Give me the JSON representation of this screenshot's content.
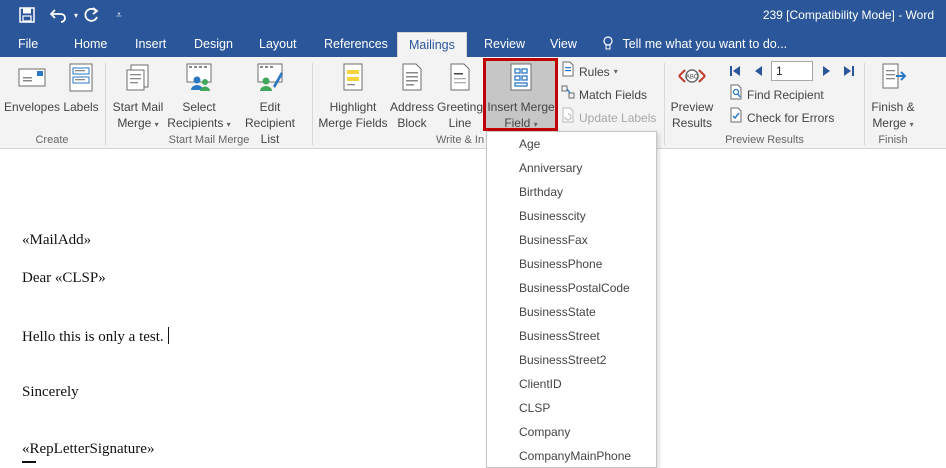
{
  "window": {
    "title": "239 [Compatibility Mode] - Word",
    "qat": {
      "save_icon": "save-icon",
      "undo_icon": "undo-icon",
      "redo_icon": "redo-icon",
      "customize_icon": "customize-qat-icon"
    }
  },
  "tabs": [
    {
      "label": "File"
    },
    {
      "label": "Home"
    },
    {
      "label": "Insert"
    },
    {
      "label": "Design"
    },
    {
      "label": "Layout"
    },
    {
      "label": "References"
    },
    {
      "label": "Mailings"
    },
    {
      "label": "Review"
    },
    {
      "label": "View"
    }
  ],
  "tell_me": "Tell me what you want to do...",
  "ribbon": {
    "create": {
      "label": "Create",
      "envelopes": "Envelopes",
      "labels": "Labels"
    },
    "start_mail_merge": {
      "label": "Start Mail Merge",
      "start_line1": "Start Mail",
      "start_line2": "Merge",
      "select_line1": "Select",
      "select_line2": "Recipients",
      "edit_line1": "Edit",
      "edit_line2": "Recipient List"
    },
    "write_insert": {
      "label": "Write & In",
      "highlight_line1": "Highlight",
      "highlight_line2": "Merge Fields",
      "address_line1": "Address",
      "address_line2": "Block",
      "greeting_line1": "Greeting",
      "greeting_line2": "Line",
      "insert_line1": "Insert Merge",
      "insert_line2": "Field",
      "rules": "Rules",
      "match_fields": "Match Fields",
      "update_labels": "Update Labels"
    },
    "preview_results": {
      "label": "Preview Results",
      "preview_line1": "Preview",
      "preview_line2": "Results",
      "record_number": "1",
      "find_recipient": "Find Recipient",
      "check_errors": "Check for Errors"
    },
    "finish": {
      "label": "Finish",
      "finish_line1": "Finish &",
      "finish_line2": "Merge"
    }
  },
  "document": {
    "lines": [
      "«MailAdd»",
      "Dear «CLSP»",
      "Hello this is only a test.",
      "Sincerely",
      "«RepLetterSignature»"
    ]
  },
  "merge_fields": [
    "Age",
    "Anniversary",
    "Birthday",
    "Businesscity",
    "BusinessFax",
    "BusinessPhone",
    "BusinessPostalCode",
    "BusinessState",
    "BusinessStreet",
    "BusinessStreet2",
    "ClientID",
    "CLSP",
    "Company",
    "CompanyMainPhone"
  ],
  "colors": {
    "title_bar": "#2b579a",
    "highlight_border": "#c00000"
  }
}
